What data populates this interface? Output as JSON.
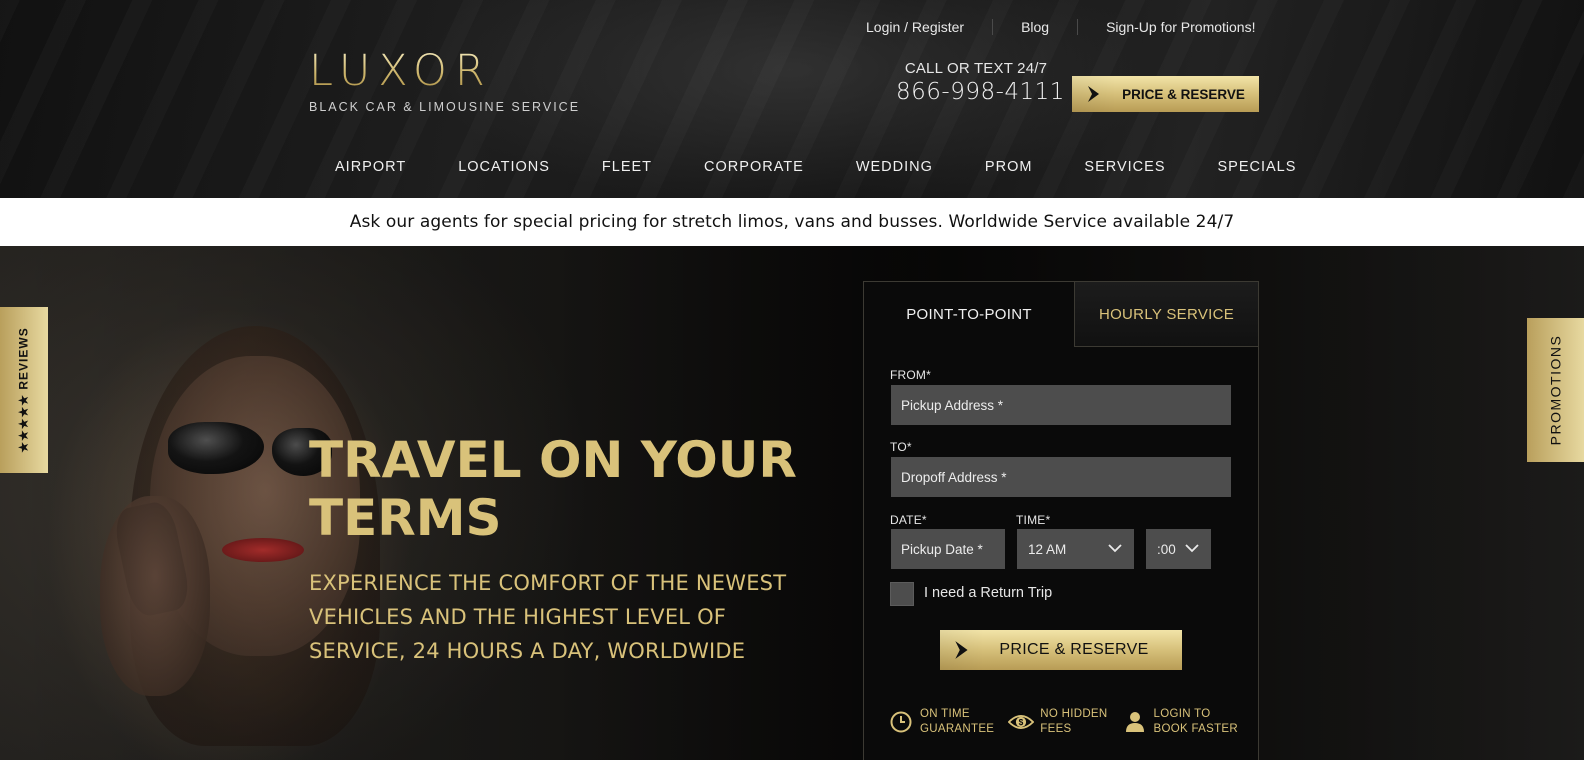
{
  "brand": {
    "logo_text": "LUXOR",
    "tagline": "BLACK CAR & LIMOUSINE SERVICE",
    "gold": "#d9c27a"
  },
  "top_links": [
    "Login / Register",
    "Blog",
    "Sign-Up for Promotions!"
  ],
  "contact": {
    "label": "CALL OR TEXT 24/7",
    "phone": "866-998-4111"
  },
  "header_button": "PRICE & RESERVE",
  "nav": [
    "AIRPORT",
    "LOCATIONS",
    "FLEET",
    "CORPORATE",
    "WEDDING",
    "PROM",
    "SERVICES",
    "SPECIALS"
  ],
  "notice": "Ask our agents for special pricing for stretch limos, vans and busses. Worldwide Service available 24/7",
  "hero": {
    "title": "TRAVEL ON YOUR TERMS",
    "subtitle": "EXPERIENCE THE COMFORT OF THE NEWEST VEHICLES AND THE HIGHEST LEVEL OF SERVICE, 24 HOURS A DAY, WORLDWIDE"
  },
  "side_tabs": {
    "reviews": "★★★★★ REVIEWS",
    "promotions": "PROMOTIONS"
  },
  "booking": {
    "tabs": [
      "POINT-TO-POINT",
      "HOURLY SERVICE"
    ],
    "from_label": "FROM*",
    "from_placeholder": "Pickup Address *",
    "to_label": "TO*",
    "to_placeholder": "Dropoff Address *",
    "date_label": "DATE*",
    "date_placeholder": "Pickup Date *",
    "time_label": "TIME*",
    "hour_value": "12 AM",
    "minute_value": ":00",
    "return_trip_label": "I need a Return Trip",
    "submit_label": "PRICE & RESERVE",
    "features": [
      {
        "icon": "clock-icon",
        "line1": "ON TIME",
        "line2": "GUARANTEE"
      },
      {
        "icon": "money-icon",
        "line1": "NO HIDDEN",
        "line2": "FEES"
      },
      {
        "icon": "user-login-icon",
        "line1": "LOGIN TO",
        "line2": "BOOK FASTER"
      }
    ]
  }
}
